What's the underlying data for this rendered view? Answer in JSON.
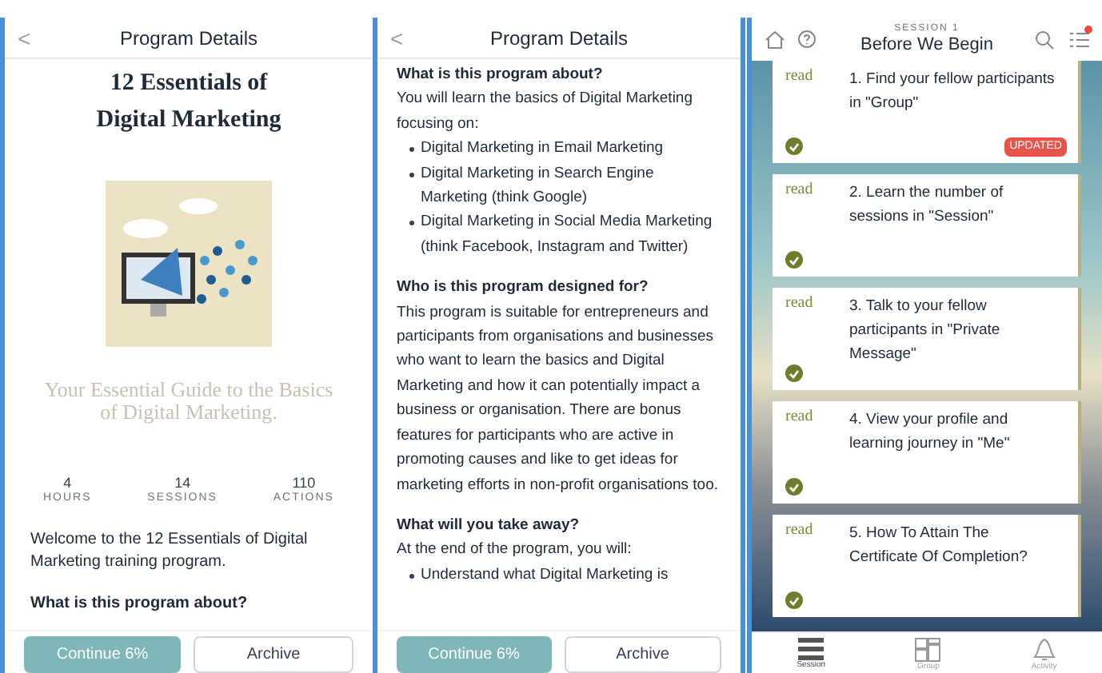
{
  "screens": [
    {
      "kind": "overview",
      "header": {
        "back": "<",
        "title": "Program Details"
      },
      "title_lines": [
        "12 Essentials of",
        "Digital Marketing"
      ],
      "tagline": "Your Essential Guide to the Basics of Digital Marketing.",
      "stats": [
        {
          "value": "4",
          "label": "HOURS"
        },
        {
          "value": "14",
          "label": "SESSIONS"
        },
        {
          "value": "110",
          "label": "ACTIONS"
        }
      ],
      "welcome": "Welcome to the 12 Essentials of Digital Marketing training program.",
      "heading": "What is this program about?",
      "buttons": {
        "continue": "Continue 6%",
        "archive": "Archive"
      }
    },
    {
      "kind": "details",
      "header": {
        "back": "<",
        "title": "Program Details"
      },
      "sections": [
        {
          "heading": "What is this program about?",
          "text": "You will learn the basics of Digital Marketing focusing on:",
          "bullets": [
            "Digital Marketing in Email Marketing",
            "Digital Marketing in Search Engine Marketing (think Google)",
            "Digital Marketing in Social Media Marketing (think Facebook, Instagram and Twitter)"
          ]
        },
        {
          "heading": "Who is this program designed for?",
          "text": "This program is suitable for entrepreneurs and participants from organisations and businesses who want to learn the basics and Digital Marketing and how it can potentially impact a business or organisation. There are bonus features for participants who are active in promoting causes and like to get ideas for marketing efforts in non-profit organisations too."
        },
        {
          "heading": "What will you take away?",
          "text": "At the end of the program, you will:",
          "bullets": [
            "Understand what Digital Marketing is"
          ]
        }
      ],
      "buttons": {
        "continue": "Continue 6%",
        "archive": "Archive"
      }
    },
    {
      "kind": "session",
      "header": {
        "eyebrow": "SESSION 1",
        "title": "Before We Begin",
        "notification": true
      },
      "cards": [
        {
          "tag": "read",
          "text": "1. Find your fellow participants in \"Group\"",
          "completed": true,
          "updated": true,
          "badge": "UPDATED"
        },
        {
          "tag": "read",
          "text": "2. Learn the number of sessions in \"Session\"",
          "completed": true,
          "updated": false
        },
        {
          "tag": "read",
          "text": "3. Talk to your fellow participants in \"Private Message\"",
          "completed": true,
          "updated": false
        },
        {
          "tag": "read",
          "text": "4. View your profile and learning journey in \"Me\"",
          "completed": true,
          "updated": false
        },
        {
          "tag": "read",
          "text": "5. How To Attain The Certificate Of Completion?",
          "completed": true,
          "updated": false
        }
      ],
      "tabs": [
        {
          "label": "Session",
          "kind": "list",
          "selected": true
        },
        {
          "label": "Group",
          "kind": "grid",
          "selected": false
        },
        {
          "label": "Activity",
          "kind": "bell",
          "selected": false
        }
      ]
    }
  ]
}
